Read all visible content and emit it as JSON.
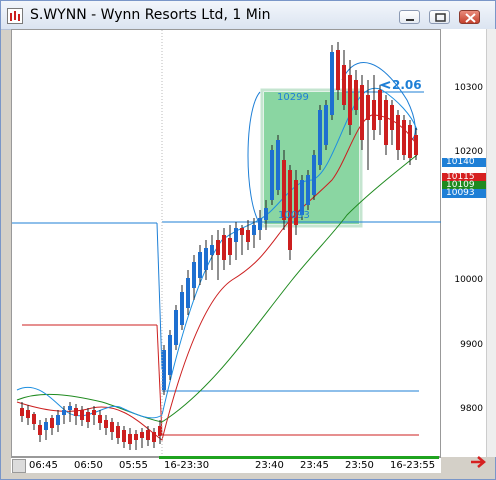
{
  "window": {
    "title": "S.WYNN - Wynn Resorts Ltd, 1 Min"
  },
  "chart": {
    "y_labels": [
      "10300",
      "10200",
      "10000",
      "9900",
      "9800"
    ],
    "x_labels": [
      "06:45",
      "06:50",
      "05:55",
      "16-23:30",
      "23:40",
      "23:45",
      "23:50",
      "16-23:55"
    ],
    "price_tags": [
      {
        "text": "10140",
        "color": "#1e7fd6"
      },
      {
        "text": "10115",
        "color": "#d62020"
      },
      {
        "text": "10109",
        "color": "#1f8a1f"
      },
      {
        "text": "10093",
        "color": "#1e7fd6"
      }
    ],
    "annotations": {
      "box_top_label": "10299",
      "box_bottom_label": "10093",
      "move_label": "2.06"
    },
    "colors": {
      "up_candle": "#1e6fd0",
      "down_candle": "#cc1f1f",
      "fast_ma": "#1e8fe0",
      "mid_ma": "#cc1f1f",
      "slow_ma": "#1f8a1f",
      "highlight_box": "#59c47a"
    },
    "icons": {
      "scroll_arrow": "right-arrow-icon",
      "app": "chart-app-icon"
    }
  }
}
